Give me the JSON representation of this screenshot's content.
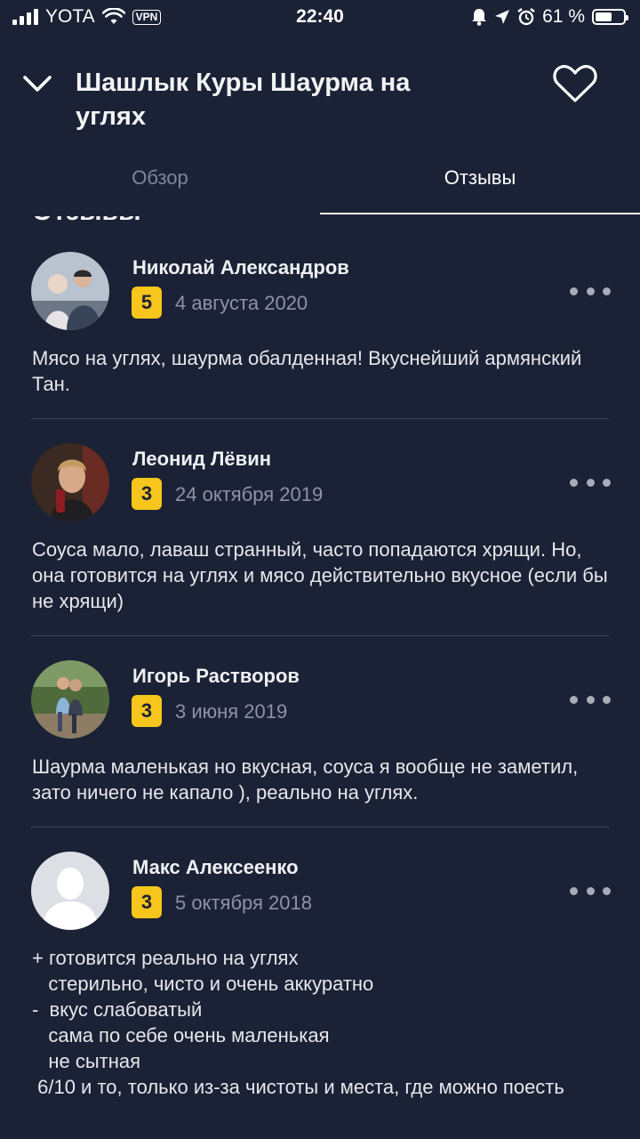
{
  "status_bar": {
    "carrier": "YOTA",
    "vpn": "VPN",
    "time": "22:40",
    "battery": "61 %",
    "battery_level": 0.61
  },
  "header": {
    "title": "Шашлык Куры Шаурма на углях",
    "back_icon": "chevron-down-icon",
    "favorite_icon": "heart-icon"
  },
  "tabs": [
    {
      "label": "Обзор",
      "active": false
    },
    {
      "label": "Отзывы",
      "active": true
    }
  ],
  "section_heading": "Отзывы",
  "reviews": [
    {
      "author": "Николай Александров",
      "rating": "5",
      "date": "4 августа 2020",
      "text": "Мясо на углях, шаурма обалденная! Вкуснейший армянский Тан."
    },
    {
      "author": "Леонид Лёвин",
      "rating": "3",
      "date": "24 октября 2019",
      "text": "Соуса мало, лаваш странный, часто попадаются хрящи. Но, она готовится на углях и мясо действительно вкусное (если бы не хрящи)"
    },
    {
      "author": "Игорь Растворов",
      "rating": "3",
      "date": "3 июня 2019",
      "text": "Шаурма маленькая но вкусная, соуса я вообще не заметил, зато ничего не капало ), реально на углях."
    },
    {
      "author": "Макс Алексеенко",
      "rating": "3",
      "date": "5 октября 2018",
      "text": "+ готовится реально на углях\n   стерильно, чисто и очень аккуратно\n-  вкус слабоватый\n   сама по себе очень маленькая\n   не сытная\n 6/10 и то, только из-за чистоты и места, где можно поесть"
    }
  ],
  "colors": {
    "background": "#1b2235",
    "rating_badge": "#f7c51b",
    "muted_text": "#8d93a3"
  }
}
